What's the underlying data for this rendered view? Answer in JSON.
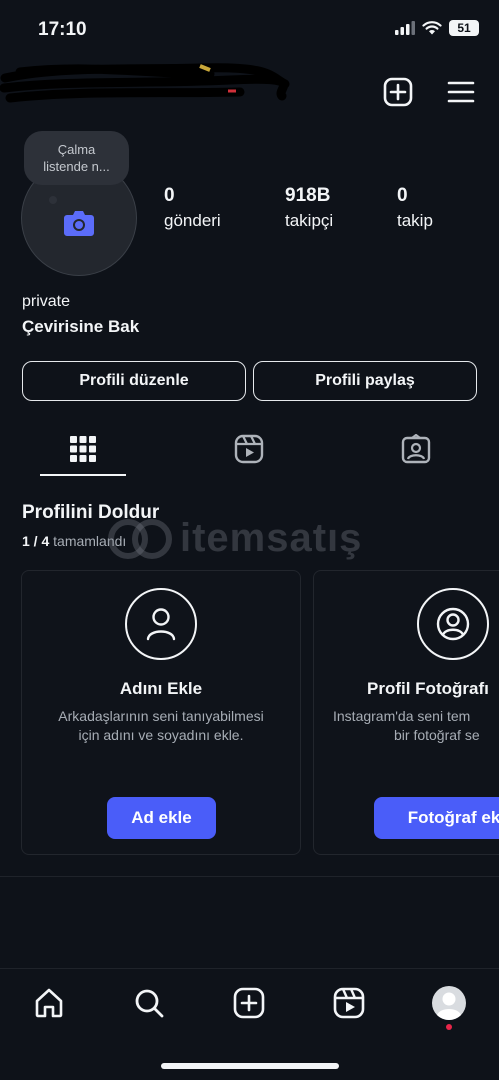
{
  "status_bar": {
    "time": "17:10",
    "battery": "51"
  },
  "profile": {
    "note": "Çalma listende n...",
    "stats": [
      {
        "value": "0",
        "label": "gönderi"
      },
      {
        "value": "918B",
        "label": "takipçi"
      },
      {
        "value": "0",
        "label": "takip"
      }
    ],
    "bio_name": "private",
    "bio_translate": "Çevirisine Bak"
  },
  "buttons": {
    "edit_profile": "Profili düzenle",
    "share_profile": "Profili paylaş"
  },
  "tabs": [
    {
      "icon": "grid-icon",
      "active": true
    },
    {
      "icon": "reels-icon",
      "active": false
    },
    {
      "icon": "tagged-icon",
      "active": false
    }
  ],
  "complete_profile": {
    "title": "Profilini Doldur",
    "progress_count": "1 / 4",
    "progress_label": "tamamlandı",
    "cards": [
      {
        "icon": "person-icon",
        "title": "Adını Ekle",
        "desc_line1": "Arkadaşlarının seni tanıyabilmesi",
        "desc_line2": "için adını ve soyadını ekle.",
        "button": "Ad ekle"
      },
      {
        "icon": "profile-photo-icon",
        "title": "Profil Fotoğrafı",
        "desc_line1": "Instagram'da seni tem",
        "desc_line2": "bir fotoğraf se",
        "button": "Fotoğraf ek"
      }
    ]
  },
  "watermark": "itemsatış",
  "bottom_nav": [
    "home-icon",
    "search-icon",
    "create-icon",
    "reels-icon",
    "profile-avatar"
  ],
  "colors": {
    "background": "#0e1219",
    "accent": "#4a5df9",
    "notification_dot": "#e8264a"
  }
}
